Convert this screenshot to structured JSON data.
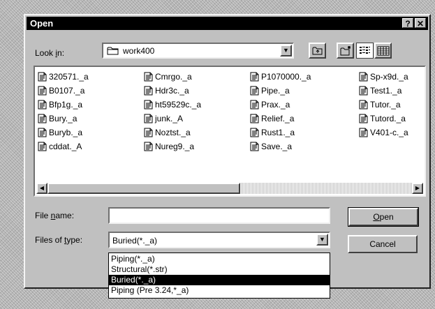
{
  "dialog": {
    "title": "Open",
    "help_button": "?",
    "close_button": "✕"
  },
  "look_in": {
    "label_pre": "Look ",
    "label_key": "i",
    "label_post": "n:",
    "value": "work400"
  },
  "files": [
    [
      "320571._a",
      "B0107._a",
      "Bfp1g._a",
      "Bury._a",
      "Buryb._a",
      "cddat._A"
    ],
    [
      "Cmrgo._a",
      "Hdr3c._a",
      "ht59529c._a",
      "junk._A",
      "Noztst._a",
      "Nureg9._a"
    ],
    [
      "P1070000._a",
      "Pipe._a",
      "Prax._a",
      "Relief._a",
      "Rust1._a",
      "Save._a"
    ],
    [
      "Sp-x9d._a",
      "Test1._a",
      "Tutor._a",
      "Tutord._a",
      "V401-c._a"
    ]
  ],
  "file_name": {
    "label_pre": "File ",
    "label_key": "n",
    "label_post": "ame:",
    "value": ""
  },
  "files_of_type": {
    "label_pre": "Files of ",
    "label_key": "t",
    "label_post": "ype:",
    "value": "Buried(*._a)",
    "options": [
      "Piping(*._a)",
      "Structural(*.str)",
      "Buried(*._a)",
      "Piping (Pre 3.24,*_a)"
    ],
    "selected_index": 2
  },
  "buttons": {
    "open_key": "O",
    "open_rest": "pen",
    "cancel": "Cancel"
  }
}
